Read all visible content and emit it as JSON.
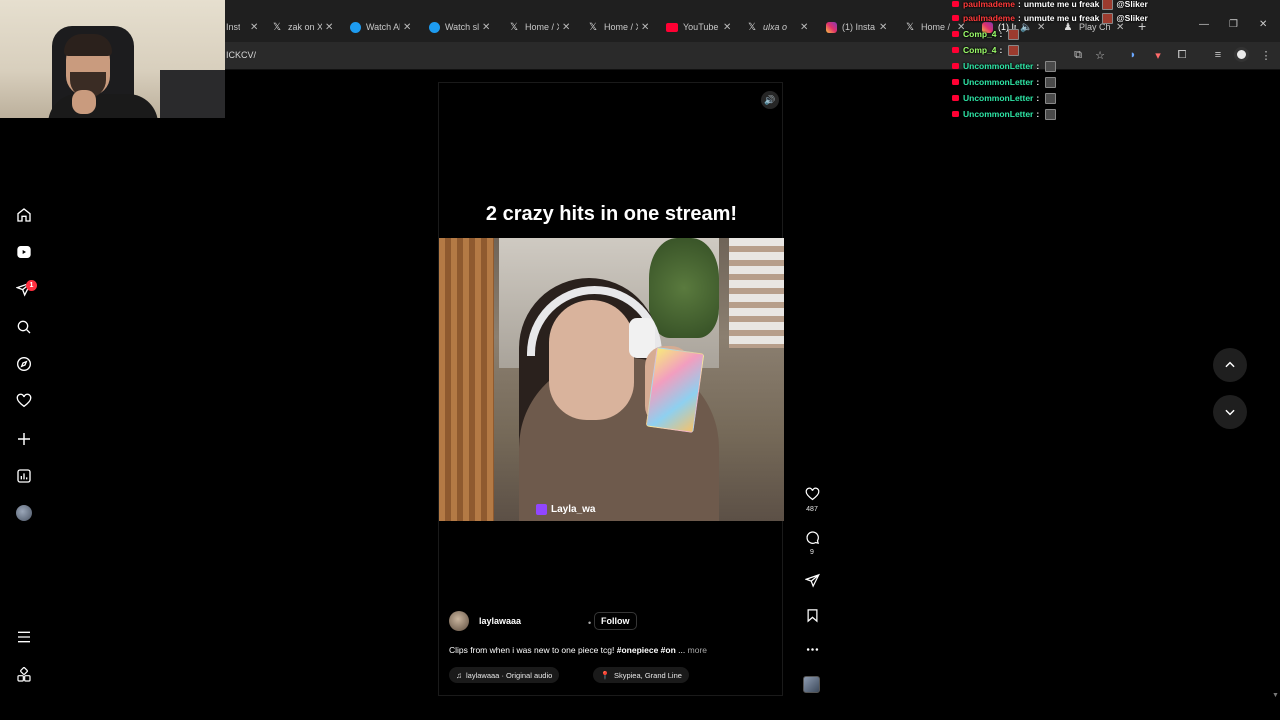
{
  "browser": {
    "tabs": [
      {
        "label": "Insta",
        "icon": "instagram-icon"
      },
      {
        "label": "zak on X",
        "icon": "x-logo-icon"
      },
      {
        "label": "Watch Al",
        "icon": "tab-favicon-icon"
      },
      {
        "label": "Watch sl",
        "icon": "tab-favicon-icon"
      },
      {
        "label": "Home / X",
        "icon": "x-logo-icon"
      },
      {
        "label": "Home / X",
        "icon": "x-logo-icon"
      },
      {
        "label": "YouTube",
        "icon": "youtube-icon"
      },
      {
        "label": "ulxa o",
        "icon": "x-logo-icon"
      },
      {
        "label": "(1) Insta",
        "icon": "instagram-icon"
      },
      {
        "label": "Home / X",
        "icon": "x-logo-icon"
      },
      {
        "label": "(1) In",
        "icon": "instagram-icon"
      },
      {
        "label": "Play Ch",
        "icon": "chess-icon"
      }
    ],
    "url": "ICKCV/"
  },
  "sidebar": {
    "items": [
      {
        "name": "home",
        "icon": "home-icon"
      },
      {
        "name": "reels",
        "icon": "reels-icon"
      },
      {
        "name": "messages",
        "icon": "send-icon",
        "badge": "1"
      },
      {
        "name": "search",
        "icon": "search-icon"
      },
      {
        "name": "explore",
        "icon": "compass-icon"
      },
      {
        "name": "notifications",
        "icon": "heart-icon"
      },
      {
        "name": "create",
        "icon": "plus-icon"
      },
      {
        "name": "dashboard",
        "icon": "chart-icon"
      },
      {
        "name": "profile",
        "icon": "avatar"
      }
    ],
    "more": "menu-icon",
    "threads": "grid-icon"
  },
  "reel": {
    "title": "2 crazy hits in one stream!",
    "video_tag": "Layla_wa",
    "author": "laylawaaa",
    "dot": "•",
    "follow_label": "Follow",
    "caption": "Clips from when i was new to one piece tcg!",
    "hashtags": "#onepiece #on",
    "ellipsis": "...",
    "more_label": "more",
    "audio": "laylawaaa · Original audio",
    "location": "Skypiea, Grand Line"
  },
  "actions": {
    "likes": "487",
    "comments": "9"
  },
  "chat": {
    "lines": [
      {
        "user": "paulmademe",
        "user_color": "#ff3b3b",
        "message": "unmute me u freak",
        "mention": "@Sliker"
      },
      {
        "user": "paulmademe",
        "user_color": "#ff3b3b",
        "message": "unmute me u freak",
        "mention": "@Sliker"
      },
      {
        "user": "Comp_4",
        "user_color": "#9dff6b",
        "message": "",
        "mention": ""
      },
      {
        "user": "Comp_4",
        "user_color": "#9dff6b",
        "message": "",
        "mention": ""
      },
      {
        "user": "UncommonLetter",
        "user_color": "#2ee6a6",
        "message": "",
        "mention": ""
      },
      {
        "user": "UncommonLetter",
        "user_color": "#2ee6a6",
        "message": "",
        "mention": ""
      },
      {
        "user": "UncommonLetter",
        "user_color": "#2ee6a6",
        "message": "",
        "mention": ""
      },
      {
        "user": "UncommonLetter",
        "user_color": "#2ee6a6",
        "message": "",
        "mention": ""
      }
    ],
    "separator": ":"
  },
  "colors": {
    "background": "#000000",
    "notification_badge": "#ff3040",
    "youtube_red": "#ff0033",
    "twitch_purple": "#9146ff"
  }
}
